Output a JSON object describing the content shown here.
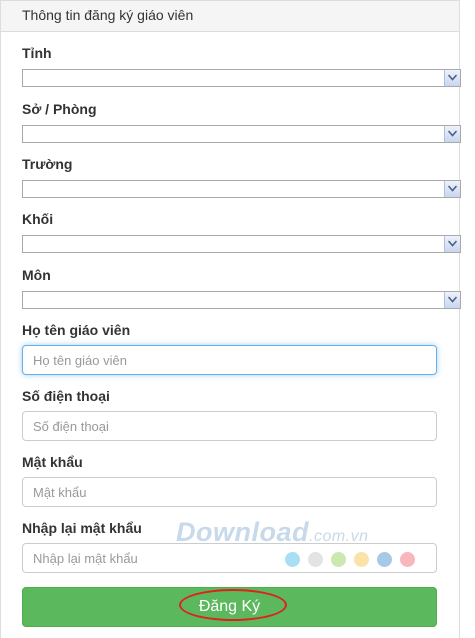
{
  "form": {
    "heading": "Thông tin đăng ký giáo viên",
    "fields": [
      {
        "label": "Tỉnh",
        "value": ""
      },
      {
        "label": "Sở / Phòng",
        "value": ""
      },
      {
        "label": "Trường",
        "value": ""
      },
      {
        "label": "Khối",
        "value": ""
      },
      {
        "label": "Môn",
        "value": ""
      }
    ],
    "inputs": [
      {
        "label": "Họ tên giáo viên",
        "placeholder": "Họ tên giáo viên",
        "value": ""
      },
      {
        "label": "Số điện thoại",
        "placeholder": "Số điện thoại",
        "value": ""
      },
      {
        "label": "Mật khẩu",
        "placeholder": "Mật khẩu",
        "value": ""
      },
      {
        "label": "Nhập lại mật khẩu",
        "placeholder": "Nhập lại mật khẩu",
        "value": ""
      }
    ],
    "submit_label": "Đăng Ký"
  },
  "watermark": {
    "brand": "Download",
    "suffix": ".com.vn",
    "dot_colors": [
      "#a9dff5",
      "#e3e3e3",
      "#cbe8b1",
      "#fbe2a8",
      "#a8c8e8",
      "#f6b8bd"
    ]
  },
  "colors": {
    "button": "#5cb85c",
    "focus_border": "#66afe9",
    "highlight": "#e02020"
  }
}
